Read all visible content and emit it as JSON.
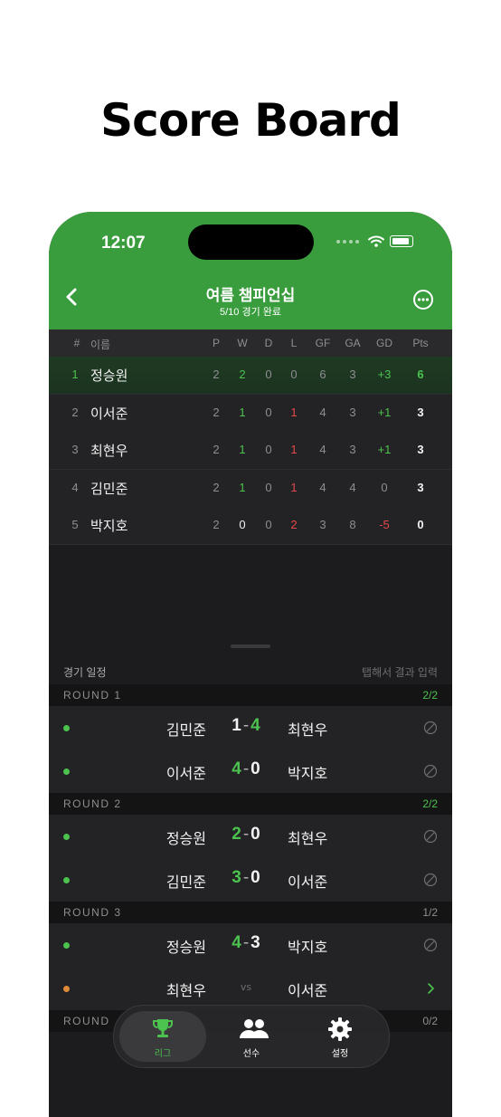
{
  "headline": "Score Board",
  "status": {
    "time": "12:07"
  },
  "nav": {
    "title": "여름 챔피언십",
    "subtitle": "5/10 경기 완료"
  },
  "table": {
    "headers": {
      "rank": "#",
      "name": "이름",
      "p": "P",
      "w": "W",
      "d": "D",
      "l": "L",
      "gf": "GF",
      "ga": "GA",
      "gd": "GD",
      "pts": "Pts"
    },
    "rows": [
      {
        "rank": "1",
        "name": "정승원",
        "p": "2",
        "w": "2",
        "d": "0",
        "l": "0",
        "gf": "6",
        "ga": "3",
        "gd": "+3",
        "pts": "6"
      },
      {
        "rank": "2",
        "name": "이서준",
        "p": "2",
        "w": "1",
        "d": "0",
        "l": "1",
        "gf": "4",
        "ga": "3",
        "gd": "+1",
        "pts": "3"
      },
      {
        "rank": "3",
        "name": "최현우",
        "p": "2",
        "w": "1",
        "d": "0",
        "l": "1",
        "gf": "4",
        "ga": "3",
        "gd": "+1",
        "pts": "3"
      },
      {
        "rank": "4",
        "name": "김민준",
        "p": "2",
        "w": "1",
        "d": "0",
        "l": "1",
        "gf": "4",
        "ga": "4",
        "gd": "0",
        "pts": "3"
      },
      {
        "rank": "5",
        "name": "박지호",
        "p": "2",
        "w": "0",
        "d": "0",
        "l": "2",
        "gf": "3",
        "ga": "8",
        "gd": "-5",
        "pts": "0"
      }
    ]
  },
  "schedule": {
    "title": "경기 일정",
    "hint": "탭해서 결과 입력",
    "vs_label": "vs",
    "rounds": [
      {
        "label": "ROUND 1",
        "count": "2/2",
        "complete": true,
        "matches": [
          {
            "home": "김민준",
            "home_score": "1",
            "away_score": "4",
            "away": "최현우",
            "played": true
          },
          {
            "home": "이서준",
            "home_score": "4",
            "away_score": "0",
            "away": "박지호",
            "played": true
          }
        ]
      },
      {
        "label": "ROUND 2",
        "count": "2/2",
        "complete": true,
        "matches": [
          {
            "home": "정승원",
            "home_score": "2",
            "away_score": "0",
            "away": "최현우",
            "played": true
          },
          {
            "home": "김민준",
            "home_score": "3",
            "away_score": "0",
            "away": "이서준",
            "played": true
          }
        ]
      },
      {
        "label": "ROUND 3",
        "count": "1/2",
        "complete": false,
        "matches": [
          {
            "home": "정승원",
            "home_score": "4",
            "away_score": "3",
            "away": "박지호",
            "played": true
          },
          {
            "home": "최현우",
            "home_score": "",
            "away_score": "",
            "away": "이서준",
            "played": false
          }
        ]
      },
      {
        "label": "ROUND",
        "count": "0/2",
        "complete": false,
        "matches": []
      }
    ]
  },
  "tabs": [
    {
      "label": "리그",
      "icon": "trophy-icon",
      "active": true
    },
    {
      "label": "선수",
      "icon": "people-icon",
      "active": false
    },
    {
      "label": "설정",
      "icon": "gear-icon",
      "active": false
    }
  ],
  "colors": {
    "accent": "#3a9d3d",
    "win": "#4cc24f",
    "loss": "#e5484d",
    "pending": "#e08a3c",
    "muted": "#8e8e93"
  }
}
